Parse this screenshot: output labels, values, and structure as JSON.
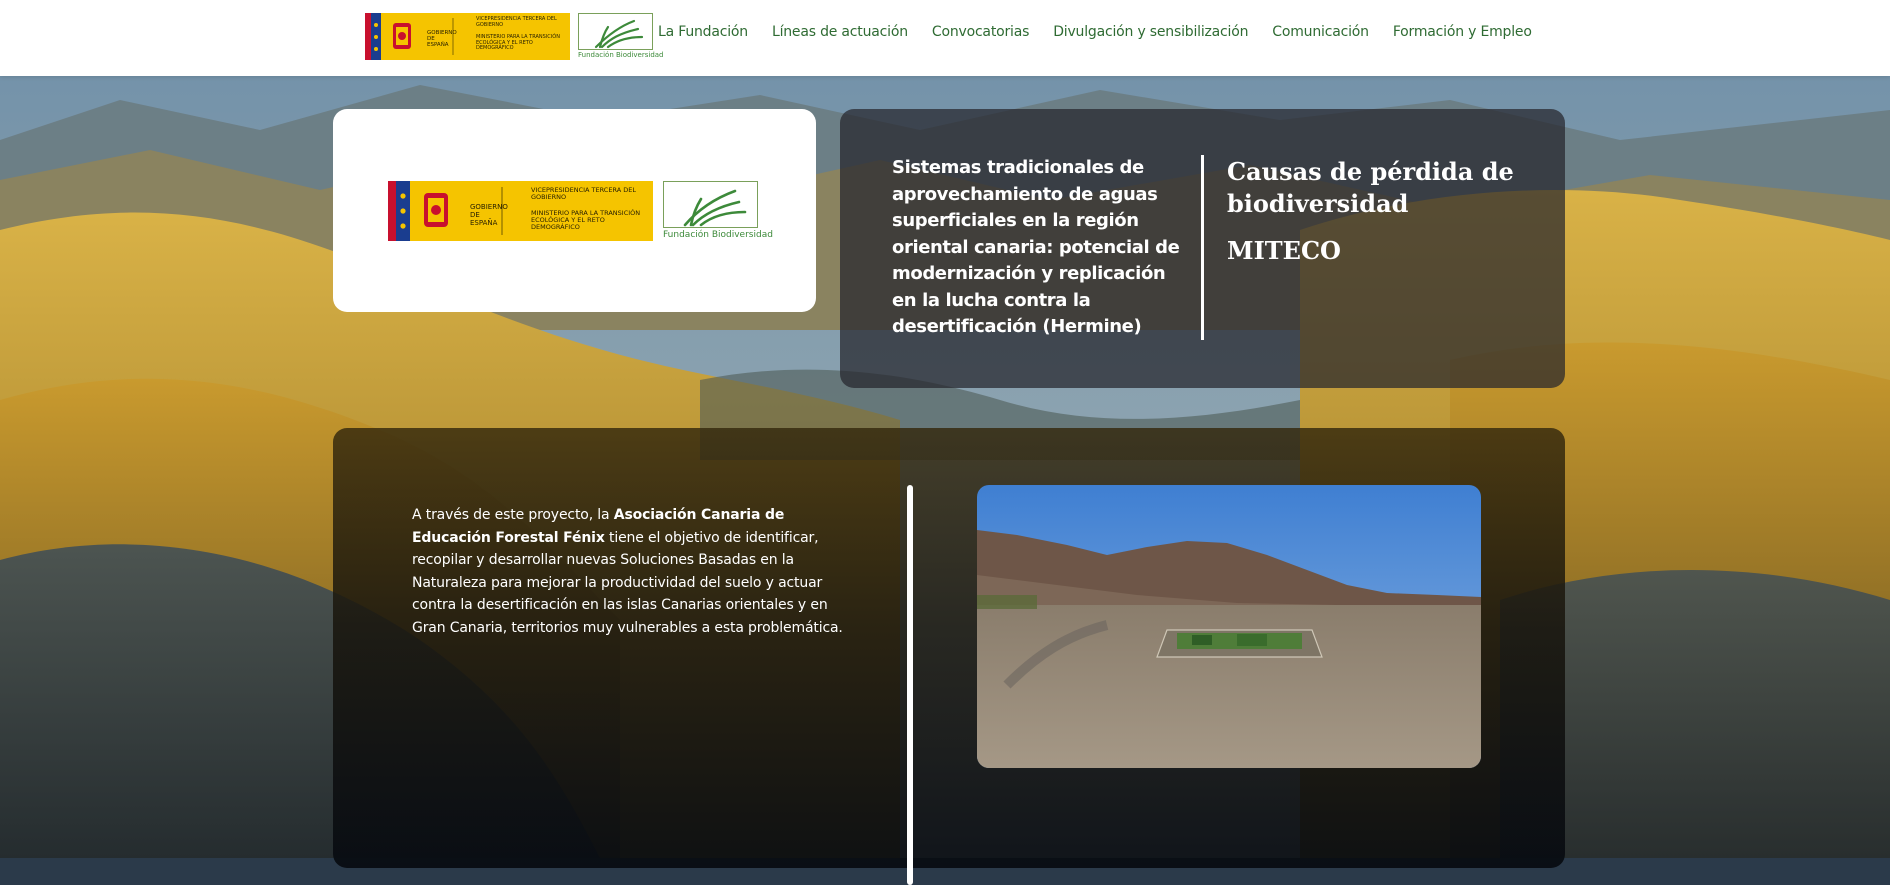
{
  "header": {
    "logo_text": {
      "gobierno": "GOBIERNO DE ESPAÑA",
      "vicepresidencia": "VICEPRESIDENCIA TERCERA DEL GOBIERNO",
      "ministerio": "MINISTERIO PARA LA TRANSICIÓN ECOLÓGICA Y EL RETO DEMOGRÁFICO",
      "fundacion": "Fundación Biodiversidad"
    },
    "nav": [
      {
        "label": "La Fundación"
      },
      {
        "label": "Líneas de actuación"
      },
      {
        "label": "Convocatorias"
      },
      {
        "label": "Divulgación y sensibilización"
      },
      {
        "label": "Comunicación"
      },
      {
        "label": "Formación y Empleo"
      }
    ]
  },
  "project": {
    "title": "Sistemas tradicionales de aprovechamiento de aguas superficiales en la región oriental canaria: potencial de modernización y replicación en la lucha contra la desertificación (Hermine)",
    "category": "Causas de pérdida de biodiversidad",
    "organization": "MITECO"
  },
  "description": {
    "lead": "A través de este proyecto, la ",
    "org_name": "Asociación Canaria de Educación Forestal Fénix",
    "rest": " tiene el objetivo de identificar, recopilar y desarrollar nuevas Soluciones Basadas en la Naturaleza para mejorar la productividad del suelo y actuar contra la desertificación en las islas Canarias orientales y en Gran Canaria, territorios muy vulnerables a esta problemática."
  },
  "colors": {
    "nav_green": "#2f6b33",
    "logo_yellow": "#f5c400",
    "logo_red": "#c8102e",
    "logo_blue": "#1a3d8f",
    "card_dark": "#26262c"
  },
  "icons": [
    "spain-coat-of-arms-icon",
    "fundacion-biodiversidad-grass-icon"
  ]
}
